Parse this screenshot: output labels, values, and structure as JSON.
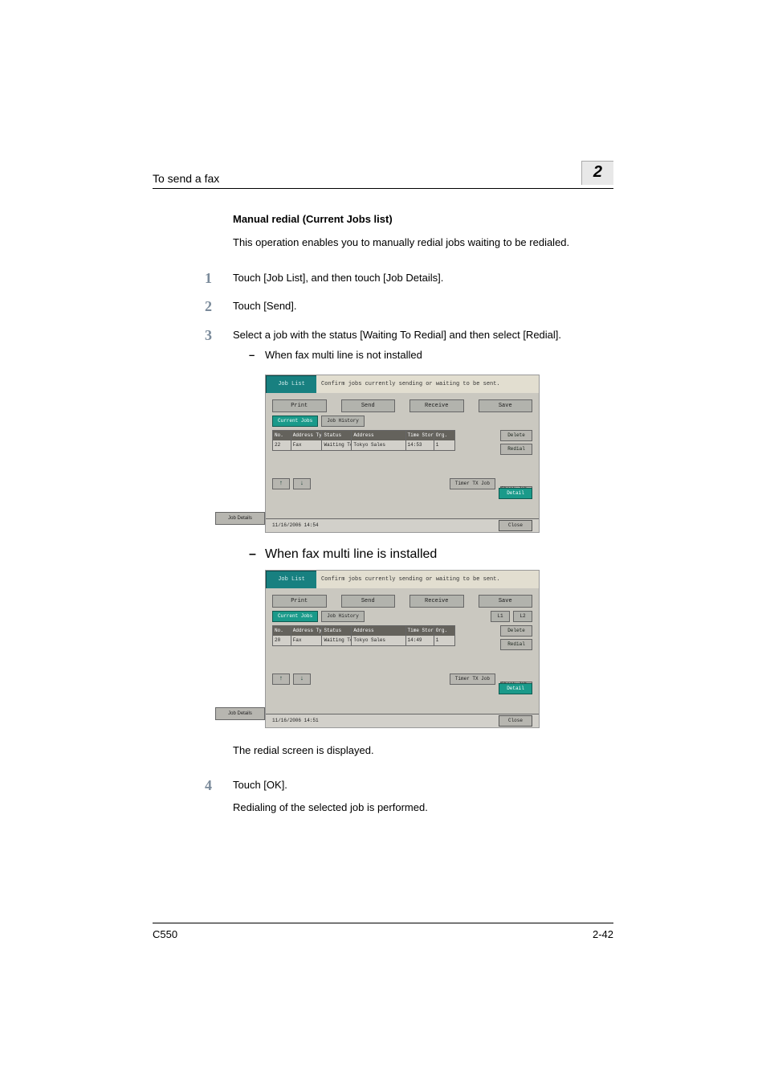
{
  "header": {
    "title": "To send a fax",
    "chapter_number": "2"
  },
  "section": {
    "heading": "Manual redial (Current Jobs list)",
    "intro": "This operation enables you to manually redial jobs waiting to be redialed."
  },
  "steps": [
    {
      "num": "1",
      "text": "Touch [Job List], and then touch [Job Details]."
    },
    {
      "num": "2",
      "text": "Touch [Send]."
    },
    {
      "num": "3",
      "text": "Select a job with the status [Waiting To Redial] and then select [Redial]."
    },
    {
      "num": "4",
      "text": "Touch [OK]."
    }
  ],
  "notes": {
    "not_installed": "When fax multi line is not installed",
    "installed": "When fax multi line is installed",
    "after_shots": "The redial screen is displayed.",
    "after_step4": "Redialing of the selected job is performed."
  },
  "panel_common": {
    "job_list_tab": "Job List",
    "caption": "Confirm jobs currently sending or waiting to be sent.",
    "tabs": {
      "print": "Print",
      "send": "Send",
      "receive": "Receive",
      "save": "Save"
    },
    "sub": {
      "current": "Current Jobs",
      "history": "Job History"
    },
    "line": {
      "l1": "L1",
      "l2": "L2"
    },
    "columns": {
      "no": "No.",
      "type": "Address Type",
      "status": "Status",
      "address": "Address",
      "time": "Time Stored",
      "org": "Org."
    },
    "side": {
      "delete": "Delete",
      "redial": "Redial",
      "check": "Check Job Set.",
      "detail": "Detail"
    },
    "bottom": {
      "timer": "Timer TX Job"
    },
    "close": "Close",
    "job_details": "Job Details"
  },
  "panel1": {
    "row": {
      "no": "22",
      "type": "Fax",
      "status": "Waiting To Redial",
      "address": "Tokyo Sales",
      "time": "14:53",
      "org": "1"
    },
    "footer_time": "11/16/2006   14:54"
  },
  "panel2": {
    "row": {
      "no": "20",
      "type": "Fax",
      "status": "Waiting To Redial",
      "address": "Tokyo Sales",
      "time": "14:49",
      "org": "1"
    },
    "footer_time": "11/16/2006   14:51"
  },
  "footer": {
    "model": "C550",
    "page": "2-42"
  }
}
